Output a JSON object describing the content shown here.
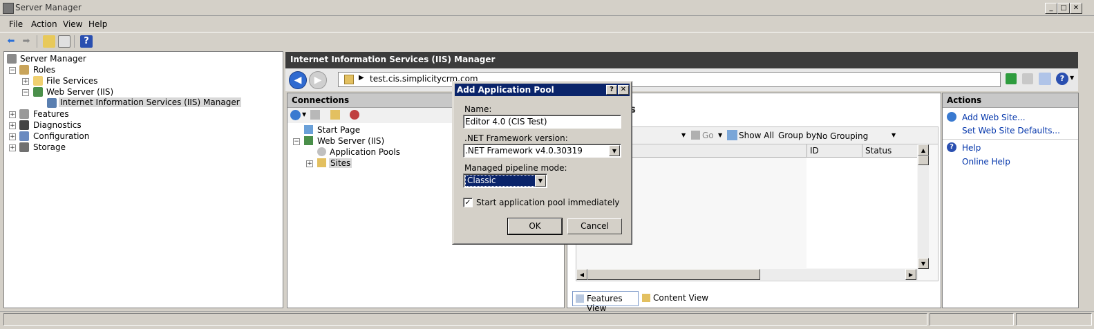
{
  "window": {
    "title": "Server Manager"
  },
  "menu": [
    "File",
    "Action",
    "View",
    "Help"
  ],
  "left_tree": {
    "root": "Server Manager",
    "roles": "Roles",
    "file_services": "File Services",
    "web_server": "Web Server (IIS)",
    "iis_manager": "Internet Information Services (IIS) Manager",
    "features": "Features",
    "diagnostics": "Diagnostics",
    "configuration": "Configuration",
    "storage": "Storage"
  },
  "iis": {
    "header": "Internet Information Services (IIS) Manager",
    "address": "test.cis.simplicitycrm.com",
    "connections_title": "Connections",
    "conn_tree": {
      "start_page": "Start Page",
      "web_server": "Web Server (IIS)",
      "app_pools": "Application Pools",
      "sites": "Sites"
    },
    "center": {
      "heading_fragment": "s",
      "go_label": "Go",
      "show_all": "Show All",
      "group_by_label": "Group by:",
      "group_by_value": "No Grouping",
      "columns": [
        "ID",
        "Status"
      ]
    },
    "views": {
      "features": "Features View",
      "content": "Content View"
    },
    "actions": {
      "title": "Actions",
      "add_web_site": "Add Web Site...",
      "set_defaults": "Set Web Site Defaults...",
      "help": "Help",
      "online_help": "Online Help"
    }
  },
  "dialog": {
    "title": "Add Application Pool",
    "name_label": "Name:",
    "name_value": "Editor 4.0 (CIS Test)",
    "framework_label": ".NET Framework version:",
    "framework_value": ".NET Framework v4.0.30319",
    "pipeline_label": "Managed pipeline mode:",
    "pipeline_value": "Classic",
    "start_label": "Start application pool immediately",
    "start_checked": true,
    "ok": "OK",
    "cancel": "Cancel"
  }
}
